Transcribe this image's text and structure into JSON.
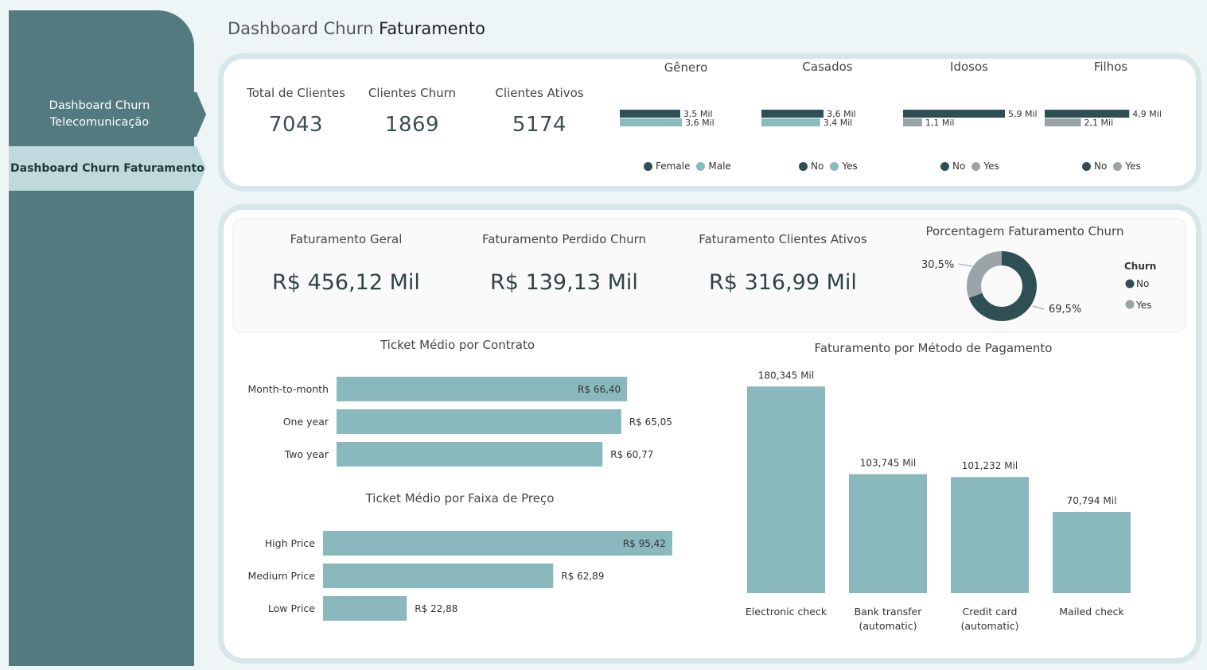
{
  "page": {
    "title_light": "Dashboard Churn",
    "title_bold": "Faturamento"
  },
  "nav": {
    "telecom_line1": "Dashboard Churn",
    "telecom_line2": "Telecomunicação",
    "faturamento": "Dashboard Churn Faturamento"
  },
  "kpis": {
    "total_label": "Total de Clientes",
    "total_value": "7043",
    "churn_label": "Clientes Churn",
    "churn_value": "1869",
    "ativos_label": "Clientes Ativos",
    "ativos_value": "5174"
  },
  "faturamento": {
    "geral_label": "Faturamento Geral",
    "geral_value": "R$ 456,12 Mil",
    "perdido_label": "Faturamento Perdido Churn",
    "perdido_value": "R$ 139,13 Mil",
    "ativos_label": "Faturamento Clientes Ativos",
    "ativos_value": "R$ 316,99 Mil"
  },
  "colors": {
    "dark": "#2e4f53",
    "light": "#89babe",
    "gray": "#9aa4a6",
    "teal_bar": "#89b9bd"
  },
  "chart_data": [
    {
      "type": "bar",
      "orientation": "horizontal",
      "title": "Gênero",
      "categories": [
        "Female",
        "Male"
      ],
      "values": [
        3.5,
        3.6
      ],
      "labels": [
        "3,5 Mil",
        "3,6 Mil"
      ],
      "legend": [
        "Female",
        "Male"
      ],
      "max": 6.0
    },
    {
      "type": "bar",
      "orientation": "horizontal",
      "title": "Casados",
      "categories": [
        "No",
        "Yes"
      ],
      "values": [
        3.6,
        3.4
      ],
      "labels": [
        "3,6 Mil",
        "3,4 Mil"
      ],
      "legend": [
        "No",
        "Yes"
      ],
      "max": 6.0
    },
    {
      "type": "bar",
      "orientation": "horizontal",
      "title": "Idosos",
      "categories": [
        "No",
        "Yes"
      ],
      "values": [
        5.9,
        1.1
      ],
      "labels": [
        "5,9 Mil",
        "1,1 Mil"
      ],
      "legend": [
        "No",
        "Yes"
      ],
      "max": 6.0
    },
    {
      "type": "bar",
      "orientation": "horizontal",
      "title": "Filhos",
      "categories": [
        "No",
        "Yes"
      ],
      "values": [
        4.9,
        2.1
      ],
      "labels": [
        "4,9 Mil",
        "2,1 Mil"
      ],
      "legend": [
        "No",
        "Yes"
      ],
      "max": 6.0
    },
    {
      "type": "pie",
      "title": "Porcentagem Faturamento Churn",
      "legend_title": "Churn",
      "categories": [
        "No",
        "Yes"
      ],
      "values": [
        69.5,
        30.5
      ],
      "labels": [
        "69,5%",
        "30,5%"
      ]
    },
    {
      "type": "bar",
      "orientation": "horizontal",
      "title": "Ticket Médio por Contrato",
      "categories": [
        "Month-to-month",
        "One year",
        "Two year"
      ],
      "values": [
        66.4,
        65.05,
        60.77
      ],
      "labels": [
        "R$ 66,40",
        "R$ 65,05",
        "R$ 60,77"
      ]
    },
    {
      "type": "bar",
      "orientation": "horizontal",
      "title": "Ticket Médio por Faixa de Preço",
      "categories": [
        "High Price",
        "Medium Price",
        "Low Price"
      ],
      "values": [
        95.42,
        62.89,
        22.88
      ],
      "labels": [
        "R$ 95,42",
        "R$ 62,89",
        "R$ 22,88"
      ]
    },
    {
      "type": "bar",
      "orientation": "vertical",
      "title": "Faturamento por Método de Pagamento",
      "categories": [
        [
          "Electronic check"
        ],
        [
          "Bank transfer",
          "(automatic)"
        ],
        [
          "Credit card",
          "(automatic)"
        ],
        [
          "Mailed check"
        ]
      ],
      "values": [
        180.345,
        103.745,
        101.232,
        70.794
      ],
      "labels": [
        "180,345 Mil",
        "103,745 Mil",
        "101,232 Mil",
        "70,794 Mil"
      ]
    }
  ]
}
